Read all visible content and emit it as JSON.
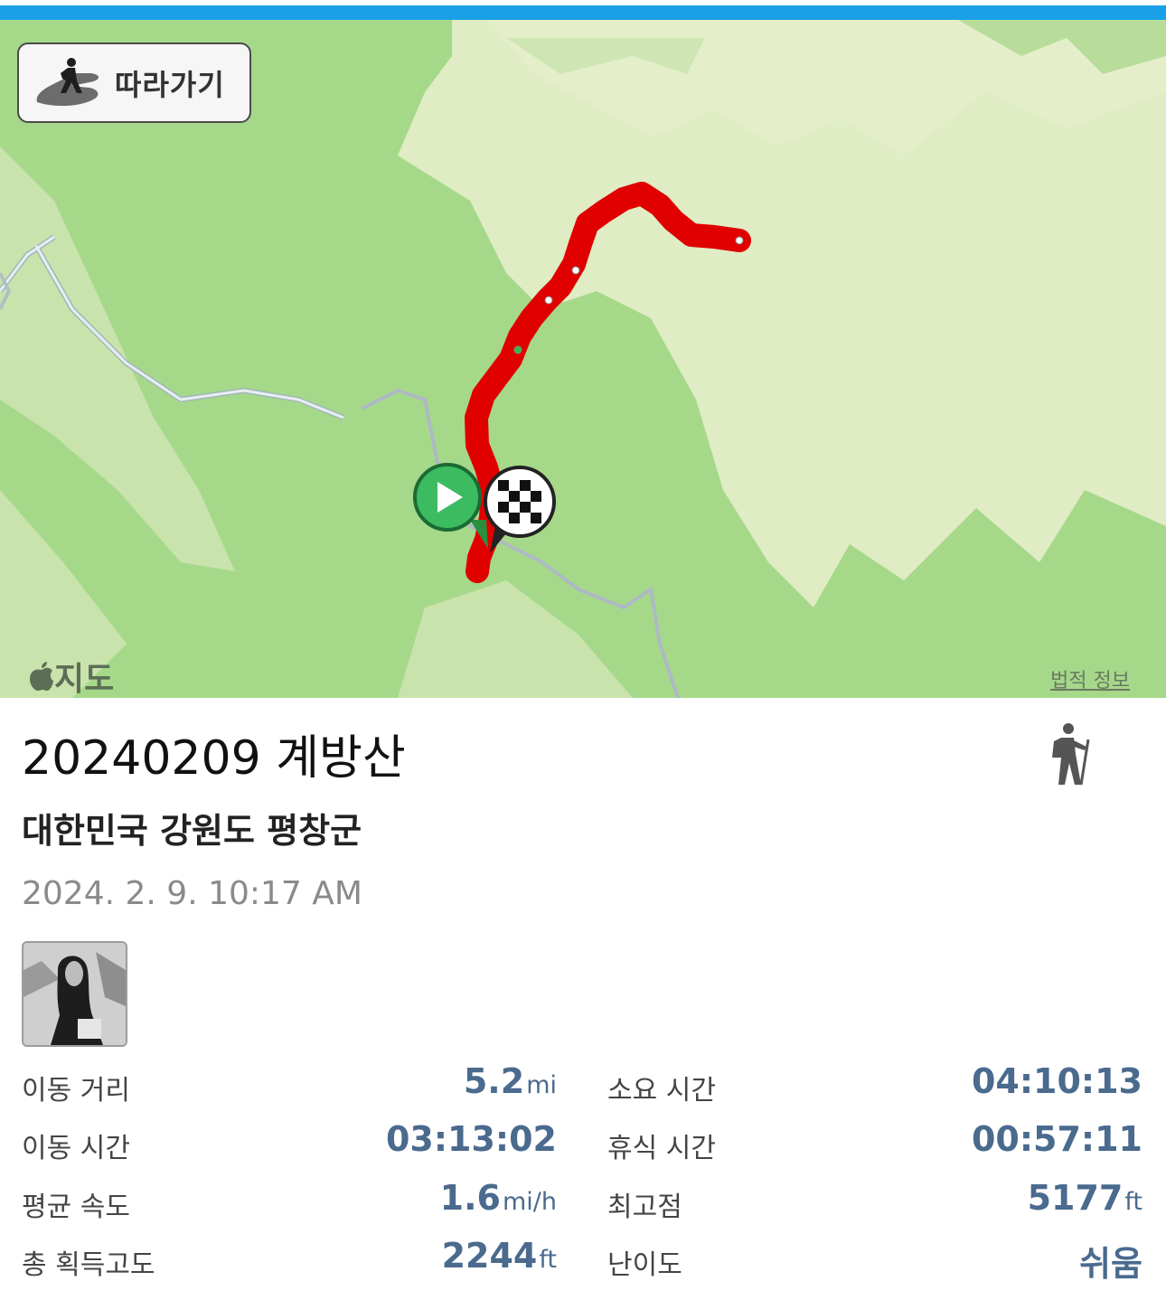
{
  "map": {
    "follow_label": "따라가기",
    "maps_brand": "지도",
    "legal_link": "법적 정보"
  },
  "activity": {
    "title": "20240209 계방산",
    "location": "대한민국 강원도 평창군",
    "datetime": "2024. 2. 9. 10:17 AM",
    "type_icon": "hiking-icon"
  },
  "stats": {
    "distance": {
      "label": "이동 거리",
      "value": "5.2",
      "unit": "mi"
    },
    "total_time": {
      "label": "소요 시간",
      "value": "04:10:13"
    },
    "moving_time": {
      "label": "이동 시간",
      "value": "03:13:02"
    },
    "rest_time": {
      "label": "휴식 시간",
      "value": "00:57:11"
    },
    "avg_speed": {
      "label": "평균 속도",
      "value": "1.6",
      "unit": "mi/h"
    },
    "max_elevation": {
      "label": "최고점",
      "value": "5177",
      "unit": "ft"
    },
    "elevation_gain": {
      "label": "총 획득고도",
      "value": "2244",
      "unit": "ft"
    },
    "difficulty": {
      "label": "난이도",
      "value": "쉬움"
    }
  },
  "colors": {
    "accent_bar": "#1aa0e6",
    "track": "#e00000",
    "value_text": "#4a6a8e",
    "map_green": "#a6d88a",
    "map_light": "#dfecc4"
  }
}
